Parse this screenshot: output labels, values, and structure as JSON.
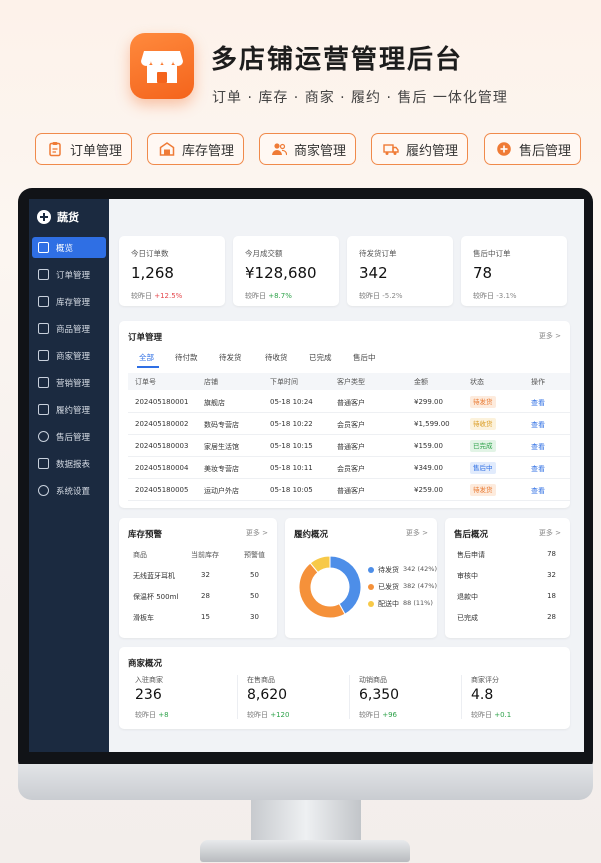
{
  "hero": {
    "title": "多店铺运营管理后台",
    "subtitle": "订单 · 库存 · 商家 · 履约 · 售后 一体化管理",
    "features": [
      {
        "label": "订单管理",
        "icon": "clipboard-icon"
      },
      {
        "label": "库存管理",
        "icon": "warehouse-icon"
      },
      {
        "label": "商家管理",
        "icon": "users-icon"
      },
      {
        "label": "履约管理",
        "icon": "truck-icon"
      },
      {
        "label": "售后管理",
        "icon": "plus-circle-icon"
      }
    ]
  },
  "sidebar": {
    "brand": "蔬货",
    "items": [
      {
        "label": "概览",
        "active": true
      },
      {
        "label": "订单管理"
      },
      {
        "label": "库存管理"
      },
      {
        "label": "商品管理"
      },
      {
        "label": "商家管理"
      },
      {
        "label": "营销管理"
      },
      {
        "label": "履约管理"
      },
      {
        "label": "售后管理"
      },
      {
        "label": "数据报表"
      },
      {
        "label": "系统设置"
      }
    ]
  },
  "stats": [
    {
      "label": "今日订单数",
      "value": "1,268",
      "cmp_label": "较昨日",
      "change": "+12.5%"
    },
    {
      "label": "今月成交额",
      "value": "¥128,680",
      "cmp_label": "较昨日",
      "change": "+8.7%"
    },
    {
      "label": "待发货订单",
      "value": "342",
      "cmp_label": "较昨日",
      "change": "-5.2%"
    },
    {
      "label": "售后中订单",
      "value": "78",
      "cmp_label": "较昨日",
      "change": "-3.1%"
    }
  ],
  "orders": {
    "title": "订单管理",
    "more": "更多 >",
    "tabs": [
      "全部",
      "待付款",
      "待发货",
      "待收货",
      "已完成",
      "售后中"
    ],
    "columns": [
      "订单号",
      "店铺",
      "下单时间",
      "客户类型",
      "金额",
      "状态",
      "操作"
    ],
    "rows": [
      {
        "id": "202405180001",
        "shop": "旗舰店",
        "time": "05-18 10:24",
        "type": "普通客户",
        "amount": "¥299.00",
        "status": "待发货",
        "action": "查看"
      },
      {
        "id": "202405180002",
        "shop": "数码专营店",
        "time": "05-18 10:22",
        "type": "会员客户",
        "amount": "¥1,599.00",
        "status": "待收货",
        "action": "查看"
      },
      {
        "id": "202405180003",
        "shop": "家居生活馆",
        "time": "05-18 10:15",
        "type": "普通客户",
        "amount": "¥159.00",
        "status": "已完成",
        "action": "查看"
      },
      {
        "id": "202405180004",
        "shop": "美妆专营店",
        "time": "05-18 10:11",
        "type": "会员客户",
        "amount": "¥349.00",
        "status": "售后中",
        "action": "查看"
      },
      {
        "id": "202405180005",
        "shop": "运动户外店",
        "time": "05-18 10:05",
        "type": "普通客户",
        "amount": "¥259.00",
        "status": "待发货",
        "action": "查看"
      }
    ],
    "status_colors": {
      "待发货": {
        "fg": "#e8762c",
        "bg": "#fdebdd"
      },
      "待收货": {
        "fg": "#d99a1e",
        "bg": "#fcf2dc"
      },
      "已完成": {
        "fg": "#2ea24a",
        "bg": "#e2f4e6"
      },
      "售后中": {
        "fg": "#2f6fe4",
        "bg": "#e1ebfc"
      }
    }
  },
  "inventory": {
    "title": "库存预警",
    "more": "更多 >",
    "columns": [
      "商品",
      "当前库存",
      "预警值"
    ],
    "rows": [
      {
        "name": "无线蓝牙耳机",
        "stock": "32",
        "warn": "50"
      },
      {
        "name": "保温杯 500ml",
        "stock": "28",
        "warn": "50"
      },
      {
        "name": "滑板车",
        "stock": "15",
        "warn": "30"
      }
    ]
  },
  "fulfillment": {
    "title": "履约概况",
    "more": "更多 >",
    "legend": [
      {
        "label": "待发货",
        "value": "342 (42%)",
        "color": "#4d8ee8"
      },
      {
        "label": "已发货",
        "value": "382 (47%)",
        "color": "#f5913a"
      },
      {
        "label": "配送中",
        "value": "88 (11%)",
        "color": "#f7c948"
      }
    ],
    "slices": [
      42,
      47,
      11
    ]
  },
  "after_sales": {
    "title": "售后概况",
    "more": "更多 >",
    "rows": [
      {
        "label": "售后申请",
        "value": "78"
      },
      {
        "label": "审核中",
        "value": "32"
      },
      {
        "label": "退款中",
        "value": "18"
      },
      {
        "label": "已完成",
        "value": "28"
      }
    ]
  },
  "merchants": {
    "title": "商家概况",
    "items": [
      {
        "label": "入驻商家",
        "value": "236",
        "cmp_label": "较昨日",
        "change": "+8"
      },
      {
        "label": "在售商品",
        "value": "8,620",
        "cmp_label": "较昨日",
        "change": "+120"
      },
      {
        "label": "动销商品",
        "value": "6,350",
        "cmp_label": "较昨日",
        "change": "+96"
      },
      {
        "label": "商家评分",
        "value": "4.8",
        "cmp_label": "较昨日",
        "change": "+0.1"
      }
    ]
  }
}
